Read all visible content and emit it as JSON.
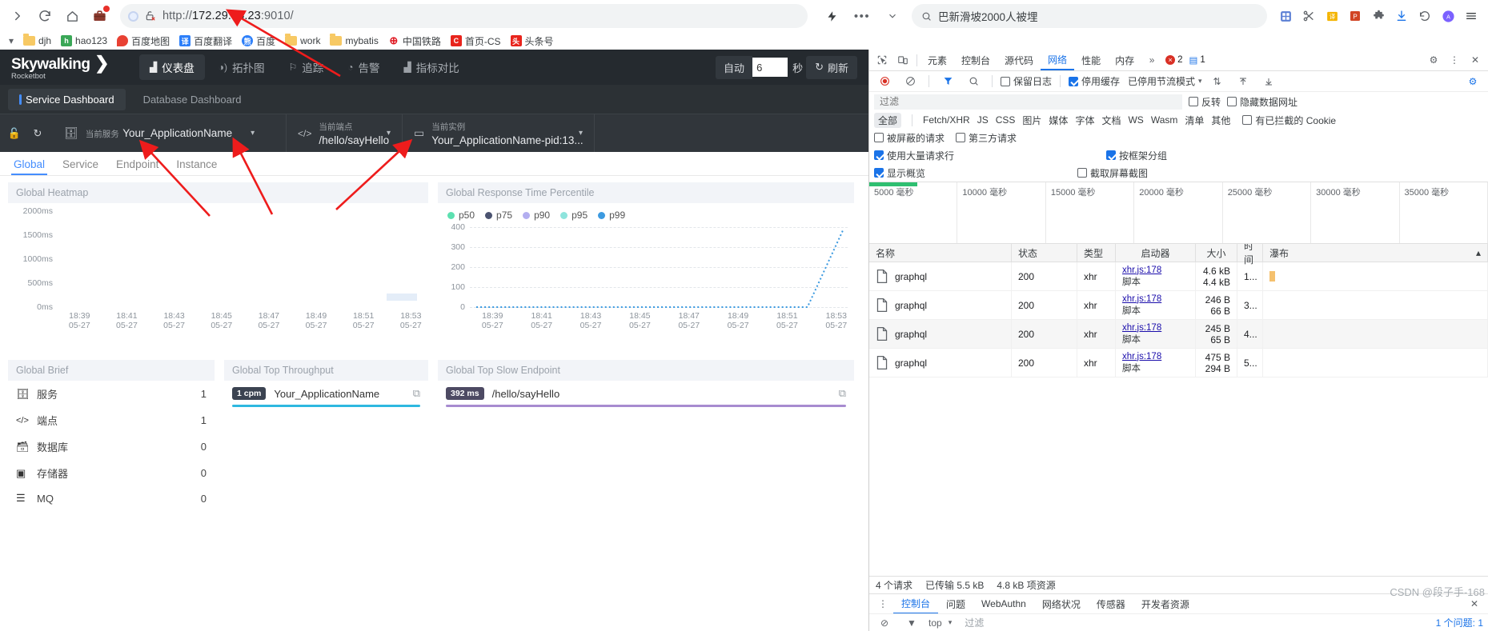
{
  "browser": {
    "url_protocol": "http://",
    "url_host": "172.29.35.23",
    "url_port": ":9010/",
    "search_placeholder": "巴新滑坡2000人被埋",
    "icons": {
      "forward": "forward-icon",
      "reload": "reload-icon",
      "home": "home-icon",
      "briefcase": "briefcase-icon",
      "lock_broken": "lock-broken-icon",
      "flash": "flash-icon",
      "more": "more-icon",
      "chevron": "chevron-down-icon",
      "search": "search-icon"
    },
    "bookmarks": [
      {
        "label": "djh",
        "type": "folder"
      },
      {
        "label": "hao123",
        "type": "site",
        "color": "#3aa757",
        "glyph": "h"
      },
      {
        "label": "百度地图",
        "type": "site",
        "color": "#e84133",
        "glyph": "◉"
      },
      {
        "label": "百度翻译",
        "type": "site",
        "color": "#2d7ff9",
        "glyph": "译"
      },
      {
        "label": "百度",
        "type": "site",
        "color": "#2d7ff9",
        "glyph": "熊"
      },
      {
        "label": "work",
        "type": "folder"
      },
      {
        "label": "mybatis",
        "type": "folder"
      },
      {
        "label": "中国铁路",
        "type": "site",
        "color": "#e01b24",
        "glyph": "⊕"
      },
      {
        "label": "首页-CS",
        "type": "site",
        "color": "#e8241c",
        "glyph": "C"
      },
      {
        "label": "头条号",
        "type": "site",
        "color": "#e8241c",
        "glyph": "头"
      }
    ]
  },
  "skywalking": {
    "logo": "Skywalking",
    "logo_sub": "Rocketbot",
    "nav": [
      {
        "label": "仪表盘",
        "icon": "dashboard-icon",
        "active": true
      },
      {
        "label": "拓扑图",
        "icon": "topology-icon",
        "active": false
      },
      {
        "label": "追踪",
        "icon": "trace-icon",
        "active": false
      },
      {
        "label": "告警",
        "icon": "alarm-icon",
        "active": false
      },
      {
        "label": "指标对比",
        "icon": "compare-icon",
        "active": false
      }
    ],
    "refresh": {
      "auto_label": "自动",
      "seconds_value": "6",
      "seconds_unit": "秒",
      "refresh_label": "刷新",
      "refresh_icon": "refresh-icon"
    },
    "sub_tabs": [
      {
        "label": "Service Dashboard",
        "active": true
      },
      {
        "label": "Database Dashboard",
        "active": false
      }
    ],
    "selector_icons": [
      "lock-icon",
      "reload-icon",
      "edit-icon"
    ],
    "selectors": [
      {
        "icon": "service-icon",
        "label": "当前服务",
        "value": "Your_ApplicationName"
      },
      {
        "icon": "endpoint-icon",
        "label": "当前端点",
        "value": "/hello/sayHello"
      },
      {
        "icon": "instance-icon",
        "label": "当前实例",
        "value": "Your_ApplicationName-pid:13..."
      }
    ],
    "tabs": [
      {
        "label": "Global",
        "active": true
      },
      {
        "label": "Service",
        "active": false
      },
      {
        "label": "Endpoint",
        "active": false
      },
      {
        "label": "Instance",
        "active": false
      }
    ],
    "panels": {
      "heatmap_title": "Global Heatmap",
      "percentile_title": "Global Response Time Percentile",
      "brief_title": "Global Brief",
      "throughput_title": "Global Top Throughput",
      "slow_endpoint_title": "Global Top Slow Endpoint"
    },
    "brief": [
      {
        "icon": "service-icon",
        "label": "服务",
        "value": "1"
      },
      {
        "icon": "endpoint-icon",
        "label": "端点",
        "value": "1"
      },
      {
        "icon": "database-icon",
        "label": "数据库",
        "value": "0"
      },
      {
        "icon": "cache-icon",
        "label": "存储器",
        "value": "0"
      },
      {
        "icon": "mq-icon",
        "label": "MQ",
        "value": "0"
      }
    ],
    "top_throughput": {
      "badge": "1 cpm",
      "name": "Your_ApplicationName",
      "bar_color": "#2eb8e0",
      "copy_icon": "copy-icon"
    },
    "top_slow_endpoint": {
      "badge": "392 ms",
      "name": "/hello/sayHello",
      "bar_color": "#a78bd0",
      "copy_icon": "copy-icon"
    }
  },
  "chart_data": [
    {
      "type": "heatmap",
      "title": "Global Heatmap",
      "ylabel": "",
      "xlabel": "",
      "yticks": [
        "0ms",
        "500ms",
        "1000ms",
        "1500ms",
        "2000ms"
      ],
      "ylim": [
        0,
        2000
      ],
      "xticks": [
        "18:39\n05-27",
        "18:41\n05-27",
        "18:43\n05-27",
        "18:45\n05-27",
        "18:47\n05-27",
        "18:49\n05-27",
        "18:51\n05-27",
        "18:53\n05-27"
      ],
      "cells": [
        {
          "x": 0.93,
          "y_bucket": "250ms",
          "value": 1,
          "color": "#e8f0fa"
        }
      ],
      "grid": false,
      "legend": "none"
    },
    {
      "type": "line",
      "title": "Global Response Time Percentile",
      "ylabel": "",
      "xlabel": "",
      "ylim": [
        0,
        400
      ],
      "yticks": [
        0,
        100,
        200,
        300,
        400
      ],
      "grid": true,
      "legend_position": "top-left",
      "categories": [
        "18:39\n05-27",
        "18:41\n05-27",
        "18:43\n05-27",
        "18:45\n05-27",
        "18:47\n05-27",
        "18:49\n05-27",
        "18:51\n05-27",
        "18:53\n05-27"
      ],
      "series": [
        {
          "name": "p50",
          "color": "#5ce0b0",
          "values": [
            0,
            0,
            0,
            0,
            0,
            0,
            0,
            0
          ]
        },
        {
          "name": "p75",
          "color": "#4b5370",
          "values": [
            0,
            0,
            0,
            0,
            0,
            0,
            0,
            0
          ]
        },
        {
          "name": "p90",
          "color": "#b3aef0",
          "values": [
            0,
            0,
            0,
            0,
            0,
            0,
            0,
            0
          ]
        },
        {
          "name": "p95",
          "color": "#8ee4dd",
          "values": [
            0,
            0,
            0,
            0,
            0,
            0,
            0,
            0
          ]
        },
        {
          "name": "p99",
          "color": "#3c9ae0",
          "values": [
            0,
            0,
            0,
            0,
            0,
            0,
            0,
            392
          ]
        }
      ]
    }
  ],
  "devtools": {
    "toolbar_icons": [
      "inspect-icon",
      "device-toolbar-icon"
    ],
    "tabs": [
      {
        "label": "元素",
        "active": false
      },
      {
        "label": "控制台",
        "active": false
      },
      {
        "label": "源代码",
        "active": false
      },
      {
        "label": "网络",
        "active": true
      },
      {
        "label": "性能",
        "active": false
      },
      {
        "label": "内存",
        "active": false
      }
    ],
    "overflow_icon": "chevron-right-icon",
    "error_count": "2",
    "warning_count": "1",
    "settings_icon": "gear-icon",
    "close_icon": "close-icon",
    "record_icon": "record-icon",
    "clear_icon": "clear-icon",
    "filter_icon": "filter-icon",
    "search_icon": "search-icon",
    "net_toolbar": {
      "preserve_log": "保留日志",
      "disable_cache": "停用缓存",
      "throttling": "已停用节流模式",
      "throttle_caret": "chevron-down-icon",
      "import_icon": "import-icon",
      "export_icon": "export-icon",
      "wifi_icon": "wifi-icon",
      "settings_icon": "gear-icon"
    },
    "filter_placeholder": "过滤",
    "invert": "反转",
    "hide_data_urls": "隐藏数据网址",
    "types": [
      "全部",
      "Fetch/XHR",
      "JS",
      "CSS",
      "图片",
      "媒体",
      "字体",
      "文档",
      "WS",
      "Wasm",
      "清单",
      "其他"
    ],
    "has_blocked_cookies": "有已拦截的 Cookie",
    "blocked_requests": "被屏蔽的请求",
    "third_party": "第三方请求",
    "big_request_rows": "使用大量请求行",
    "group_by_frame": "按框架分组",
    "show_overview": "显示概览",
    "capture_screenshots": "截取屏幕截图",
    "overview_ticks": [
      "5000 毫秒",
      "10000 毫秒",
      "15000 毫秒",
      "20000 毫秒",
      "25000 毫秒",
      "30000 毫秒",
      "35000 毫秒"
    ],
    "columns": [
      "名称",
      "状态",
      "类型",
      "启动器",
      "大小",
      "时间",
      "瀑布"
    ],
    "rows": [
      {
        "name": "graphql",
        "status": "200",
        "type": "xhr",
        "initiator": "xhr.js:178",
        "initiator_sub": "脚本",
        "size": "4.6 kB",
        "size_sub": "4.4 kB",
        "time": "1...",
        "time_sub": "1"
      },
      {
        "name": "graphql",
        "status": "200",
        "type": "xhr",
        "initiator": "xhr.js:178",
        "initiator_sub": "脚本",
        "size": "246 B",
        "size_sub": "66 B",
        "time": "3...",
        "time_sub": "3"
      },
      {
        "name": "graphql",
        "status": "200",
        "type": "xhr",
        "initiator": "xhr.js:178",
        "initiator_sub": "脚本",
        "size": "245 B",
        "size_sub": "65 B",
        "time": "4...",
        "time_sub": "4"
      },
      {
        "name": "graphql",
        "status": "200",
        "type": "xhr",
        "initiator": "xhr.js:178",
        "initiator_sub": "脚本",
        "size": "475 B",
        "size_sub": "294 B",
        "time": "5...",
        "time_sub": "5"
      }
    ],
    "status": {
      "requests": "4 个请求",
      "transferred": "已传输 5.5 kB",
      "resources": "4.8 kB 项资源"
    },
    "drawer_tabs": [
      {
        "label": "控制台",
        "active": true
      },
      {
        "label": "问题",
        "active": false
      },
      {
        "label": "WebAuthn",
        "active": false
      },
      {
        "label": "网络状况",
        "active": false
      },
      {
        "label": "传感器",
        "active": false
      },
      {
        "label": "开发者资源",
        "active": false
      }
    ],
    "console_scope": "top",
    "console_filter": "过滤",
    "console_msg": "1 个问题: 1"
  },
  "watermark": {
    "text": "CSDN @段子手-168"
  }
}
